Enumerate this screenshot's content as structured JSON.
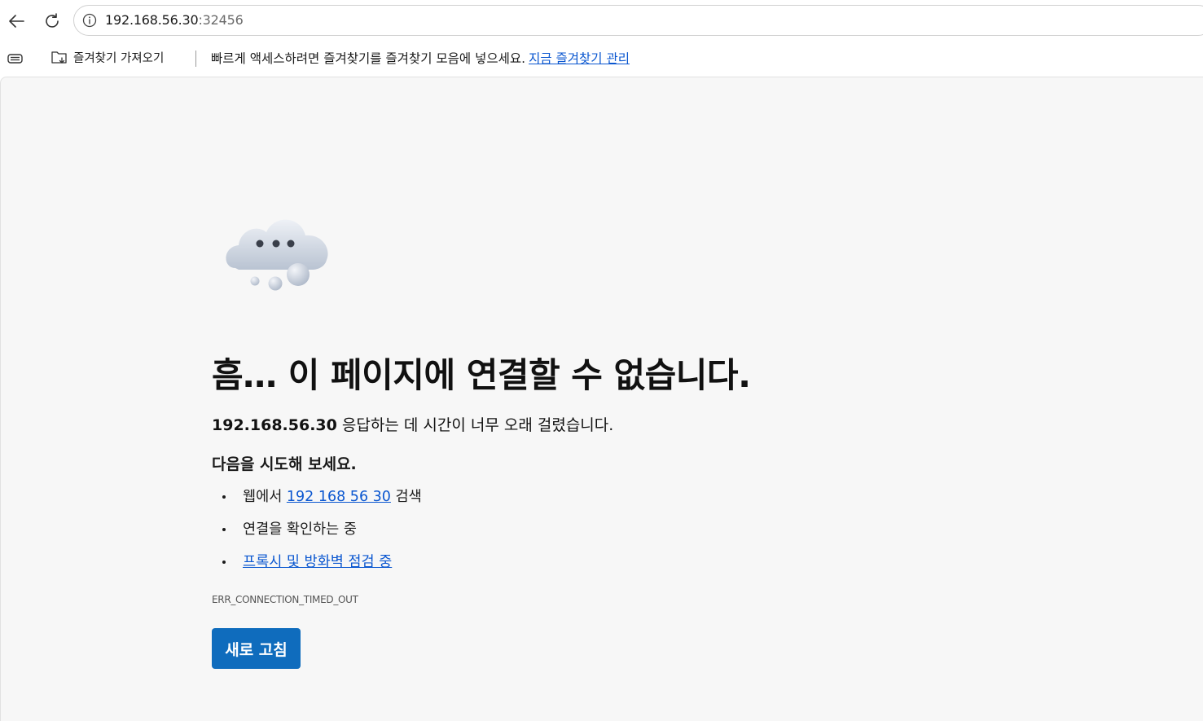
{
  "browser": {
    "address": {
      "host": "192.168.56.30",
      "port": ":32456"
    }
  },
  "favorites_bar": {
    "import_label": "즐겨찾기 가져오기",
    "message": "빠르게 액세스하려면 즐겨찾기를 즐겨찾기 모음에 넣으세요.",
    "manage_link": "지금 즐겨찾기 관리"
  },
  "error_page": {
    "headline": "흠… 이 페이지에 연결할 수 없습니다.",
    "host_bold": "192.168.56.30",
    "sub_message": " 응답하는 데 시간이 너무 오래 걸렸습니다.",
    "try_heading": "다음을 시도해 보세요.",
    "suggestions": {
      "search_prefix": "웹에서 ",
      "search_link": "192 168 56 30",
      "search_suffix": " 검색",
      "check_connection": "연결을 확인하는 중",
      "proxy_link": "프록시 및 방화벽 점검 중"
    },
    "error_code": "ERR_CONNECTION_TIMED_OUT",
    "refresh_label": "새로 고침"
  },
  "colors": {
    "accent": "#0f6cbd",
    "link": "#0b57d0",
    "page_bg": "#f7f7f7"
  }
}
